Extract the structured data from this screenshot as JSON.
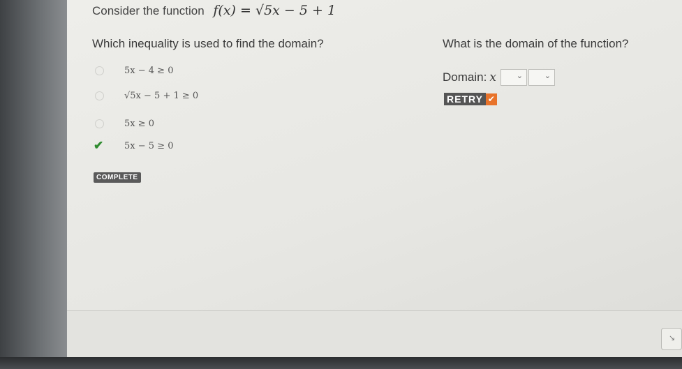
{
  "question": {
    "prompt": "Consider the function",
    "function": "f(x) = √5x − 5 + 1"
  },
  "part1": {
    "question": "Which inequality is used to find the domain?",
    "options": [
      {
        "text": "5x − 4 ≥ 0",
        "selected": false
      },
      {
        "text": "√5x − 5 + 1 ≥ 0",
        "selected": false
      },
      {
        "text": "5x ≥ 0",
        "selected": false
      },
      {
        "text": "5x − 5 ≥ 0",
        "selected": true
      }
    ],
    "status": "COMPLETE"
  },
  "part2": {
    "question": "What is the domain of the function?",
    "domain_label": "Domain:",
    "variable": "x",
    "selects": [
      "",
      ""
    ],
    "retry_label": "RETRY",
    "retry_icon": "checkmark"
  },
  "colors": {
    "check": "#2e8b2e",
    "retry_accent": "#e8732a"
  }
}
